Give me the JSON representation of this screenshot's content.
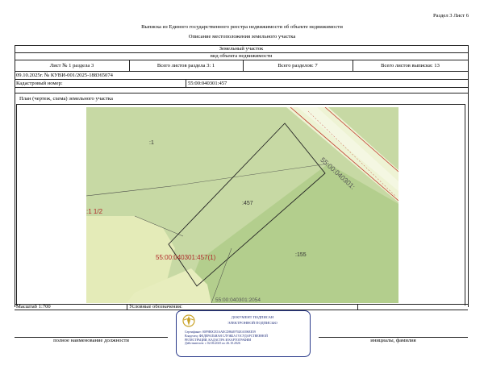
{
  "header": {
    "section_sheet": "Раздел 3   Лист 6",
    "title": "Выписка из Единого государственного реестра недвижимости об объекте недвижимости",
    "subtitle": "Описание местоположения земельного участка"
  },
  "object": {
    "type": "Земельный участок",
    "type_caption": "вид объекта недвижимости"
  },
  "sheet_info": {
    "sheet_of_section": "Лист № 1 раздела 3",
    "sheets_in_section": "Всего листов раздела 3: 1",
    "sections_total": "Всего разделов: 7",
    "sheets_total": "Всего листов выписки: 13"
  },
  "record": {
    "date_number": "09.10.2025г. № КУВИ-001/2025-188365074",
    "cadastral_label": "Кадастровый номер:",
    "cadastral_number": "55:00:040301:457"
  },
  "plan": {
    "caption": "План (чертеж, схема) земельного участка",
    "labels": {
      "parcel_1": ":1",
      "parcel_457": ":457",
      "parcel_155": ":155",
      "parcel_left": ":1 1/2",
      "parcel_main": "55:00:040301:457(1)",
      "street": "55:00:040301:",
      "bottom": "55:00:040301:2054"
    },
    "colors": {
      "light_green": "#c7d9a4",
      "mid_green": "#b3ce8d",
      "yellow_zone": "#e7edbd",
      "road": "#eef3d4",
      "parcel_line": "#222222",
      "red_line": "#c0392b",
      "label_red": "#b02a2a"
    }
  },
  "footer": {
    "scale": "Масштаб 1:700",
    "legend": "Условные обозначения:",
    "position_caption": "полное наименование должности",
    "name_caption": "инициалы, фамилия"
  },
  "stamp": {
    "line1": "ДОКУМЕНТ ПОДПИСАН",
    "line2": "ЭЛЕКТРОННОЙ ПОДПИСЬЮ",
    "cert": "Сертификат: 00F9B0CE5AAECD8649792EA396EE59",
    "owner_line1": "Владелец: ФЕДЕРАЛЬНАЯ СЛУЖБА ГОСУДАРСТВЕННОЙ",
    "owner_line2": "РЕГИСТРАЦИИ, КАДАСТРА И КАРТОГРАФИИ",
    "valid": "Действителен: с 02.06.2025 по 26.10.2026",
    "emblem_color": "#c9a227",
    "border_color": "#2a3a8a"
  }
}
